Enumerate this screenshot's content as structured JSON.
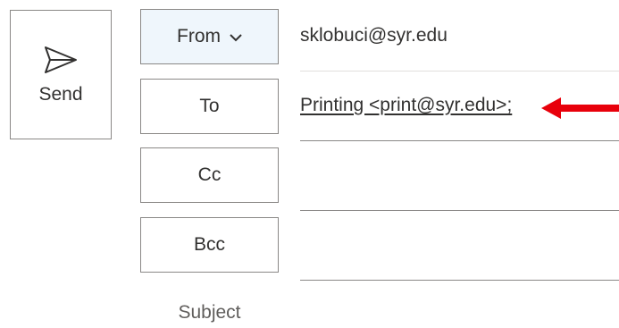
{
  "send": {
    "label": "Send",
    "icon": "send-icon"
  },
  "header_buttons": {
    "from_label": "From",
    "to_label": "To",
    "cc_label": "Cc",
    "bcc_label": "Bcc",
    "subject_label": "Subject"
  },
  "fields": {
    "from_value": "sklobuci@syr.edu",
    "to_recipient": "Printing <print@syr.edu>;",
    "cc_value": "",
    "bcc_value": ""
  },
  "colors": {
    "accent_arrow": "#e8000b",
    "from_button_bg": "#eff6fc",
    "border": "#8a8886"
  }
}
